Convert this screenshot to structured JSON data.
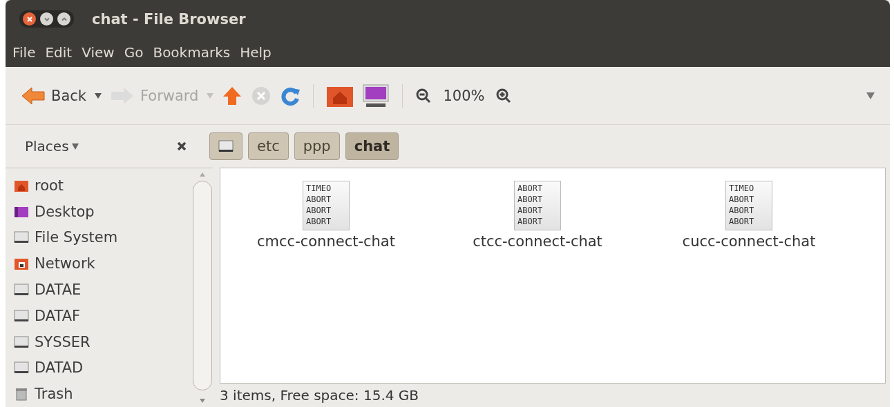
{
  "window": {
    "title": "chat - File Browser"
  },
  "menu": [
    "File",
    "Edit",
    "View",
    "Go",
    "Bookmarks",
    "Help"
  ],
  "toolbar": {
    "back": {
      "label": "Back",
      "disabled": false
    },
    "forward": {
      "label": "Forward",
      "disabled": true
    },
    "zoom": "100%"
  },
  "sidebar": {
    "title": "Places",
    "items": [
      {
        "label": "root",
        "kind": "home"
      },
      {
        "label": "Desktop",
        "kind": "desktop"
      },
      {
        "label": "File System",
        "kind": "drive"
      },
      {
        "label": "Network",
        "kind": "network"
      },
      {
        "label": "DATAE",
        "kind": "drive"
      },
      {
        "label": "DATAF",
        "kind": "drive"
      },
      {
        "label": "SYSSER",
        "kind": "drive"
      },
      {
        "label": "DATAD",
        "kind": "drive"
      },
      {
        "label": "Trash",
        "kind": "trash"
      }
    ]
  },
  "path": [
    {
      "kind": "drive",
      "selected": false
    },
    {
      "label": "etc",
      "kind": "folder",
      "selected": false
    },
    {
      "label": "ppp",
      "kind": "folder",
      "selected": false
    },
    {
      "label": "chat",
      "kind": "folder",
      "selected": true
    }
  ],
  "files": [
    {
      "name": "cmcc-connect-chat",
      "preview": [
        "TIMEO",
        "ABORT",
        "ABORT",
        "ABORT"
      ]
    },
    {
      "name": "ctcc-connect-chat",
      "preview": [
        "ABORT",
        "ABORT",
        "ABORT",
        "ABORT"
      ]
    },
    {
      "name": "cucc-connect-chat",
      "preview": [
        "TIMEO",
        "ABORT",
        "ABORT",
        "ABORT"
      ]
    }
  ],
  "status_bar": "3 items, Free space: 15.4 GB"
}
